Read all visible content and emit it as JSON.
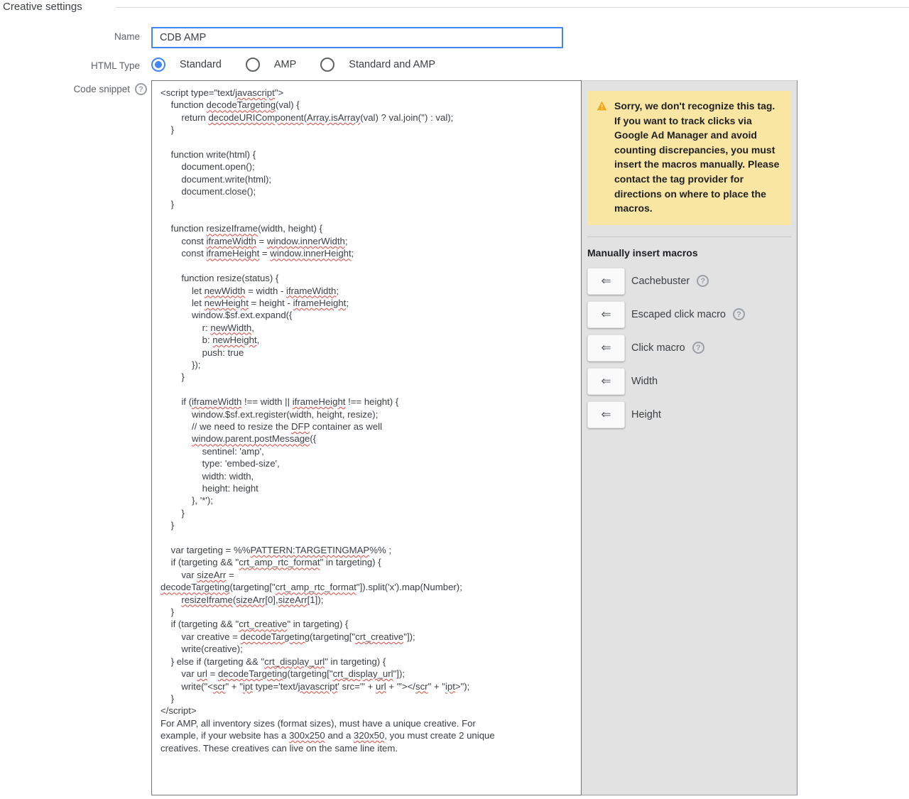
{
  "page": {
    "title": "Creative settings"
  },
  "form": {
    "name": {
      "label": "Name",
      "value": "CDB AMP"
    },
    "html_type": {
      "label": "HTML Type",
      "options": [
        {
          "label": "Standard",
          "selected": true
        },
        {
          "label": "AMP",
          "selected": false
        },
        {
          "label": "Standard and AMP",
          "selected": false
        }
      ]
    },
    "code_snippet": {
      "label": "Code snippet",
      "code_lines": [
        "<script type=\"text/javascript\">",
        "    function decodeTargeting(val) {",
        "        return decodeURIComponent(Array.isArray(val) ? val.join('') : val);",
        "    }",
        "",
        "    function write(html) {",
        "        document.open();",
        "        document.write(html);",
        "        document.close();",
        "    }",
        "",
        "    function resizeIframe(width, height) {",
        "        const iframeWidth = window.innerWidth;",
        "        const iframeHeight = window.innerHeight;",
        "",
        "        function resize(status) {",
        "            let newWidth = width - iframeWidth;",
        "            let newHeight = height - iframeHeight;",
        "            window.$sf.ext.expand({",
        "                r: newWidth,",
        "                b: newHeight,",
        "                push: true",
        "            });",
        "        }",
        "",
        "        if (iframeWidth !== width || iframeHeight !== height) {",
        "            window.$sf.ext.register(width, height, resize);",
        "            // we need to resize the DFP container as well",
        "            window.parent.postMessage({",
        "                sentinel: 'amp',",
        "                type: 'embed-size',",
        "                width: width,",
        "                height: height",
        "            }, '*');",
        "        }",
        "    }",
        "",
        "    var targeting = %%PATTERN:TARGETINGMAP%% ;",
        "    if (targeting && \"crt_amp_rtc_format\" in targeting) {",
        "        var sizeArr =",
        "decodeTargeting(targeting[\"crt_amp_rtc_format\"]).split('x').map(Number);",
        "        resizeIframe(sizeArr[0],sizeArr[1]);",
        "    }",
        "    if (targeting && \"crt_creative\" in targeting) {",
        "        var creative = decodeTargeting(targeting[\"crt_creative\"]);",
        "        write(creative);",
        "    } else if (targeting && \"crt_display_url\" in targeting) {",
        "        var url = decodeTargeting(targeting[\"crt_display_url\"]);",
        "        write(\"<scr\" + \"ipt type='text/javascript' src='\" + url + \"'></scr\" + \"ipt>\");",
        "    }",
        "</script>",
        "For AMP, all inventory sizes (format sizes), must have a unique creative. For",
        "example, if your website has a 300x250 and a 320x50, you must create 2 unique",
        "creatives. These creatives can live on the same line item."
      ],
      "spellcheck_words": [
        "window.parent.postMessage",
        "PATTERN:TARGETINGMAP",
        "decodeURIComponent",
        "window.innerWidth",
        "window.innerHeight",
        "crt_amp_rtc_format",
        "crt_display_url",
        "decodeTargeting",
        "Array.isArray",
        "resizeIframe",
        "iframeWidth",
        "iframeHeight",
        "crt_creative",
        "newWidth",
        "newHeight",
        "sizeArr",
        "300x250",
        "320x50",
        "javascript",
        "DFP",
        "url",
        "scr",
        "ipt"
      ]
    }
  },
  "warning": {
    "text": "Sorry, we don't recognize this tag. If you want to track clicks via Google Ad Manager and avoid counting discrepancies, you must insert the macros manually. Please contact the tag provider for directions on where to place the macros."
  },
  "macros": {
    "title": "Manually insert macros",
    "items": [
      {
        "label": "Cachebuster",
        "help": true
      },
      {
        "label": "Escaped click macro",
        "help": true
      },
      {
        "label": "Click macro",
        "help": true
      },
      {
        "label": "Width",
        "help": false
      },
      {
        "label": "Height",
        "help": false
      }
    ]
  },
  "icons": {
    "insert_arrow": "⇐",
    "help_glyph": "?"
  },
  "colors": {
    "accent_blue": "#4285F4",
    "warning_bg": "#F9E6A2",
    "warning_icon": "#F4A61D",
    "panel_bg": "#E2E2E2",
    "spellcheck_red": "#E8453C"
  }
}
